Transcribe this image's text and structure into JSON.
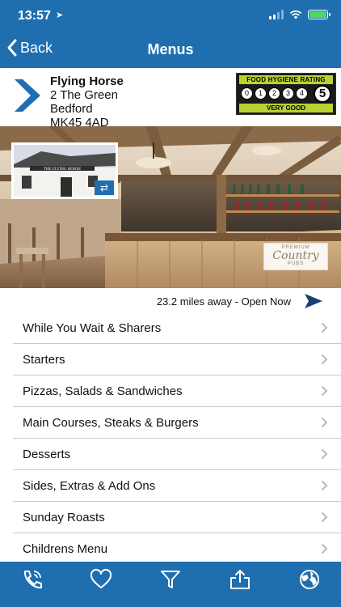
{
  "status_bar": {
    "time": "13:57"
  },
  "nav": {
    "back_label": "Back",
    "title": "Menus"
  },
  "venue": {
    "name": "Flying Horse",
    "address_line1": "2 The Green",
    "address_line2": "Bedford",
    "postcode": "MK45 4AD"
  },
  "hygiene_rating": {
    "header": "FOOD HYGIENE RATING",
    "scale": [
      "0",
      "1",
      "2",
      "3",
      "4"
    ],
    "rating": "5",
    "label": "VERY GOOD"
  },
  "hero": {
    "thumb_sign": "THE FLYING HORSE",
    "brand_top": "PREMIUM",
    "brand_main": "Country",
    "brand_bottom": "PUBS"
  },
  "distance": {
    "text": "23.2 miles away - Open Now"
  },
  "menu_items": [
    {
      "label": "While You Wait & Sharers"
    },
    {
      "label": "Starters"
    },
    {
      "label": "Pizzas, Salads & Sandwiches"
    },
    {
      "label": "Main Courses, Steaks & Burgers"
    },
    {
      "label": "Desserts"
    },
    {
      "label": "Sides, Extras & Add Ons"
    },
    {
      "label": "Sunday Roasts"
    },
    {
      "label": "Childrens Menu"
    }
  ],
  "tab_bar": [
    "phone-icon",
    "heart-icon",
    "filter-icon",
    "share-icon",
    "globe-icon"
  ],
  "colors": {
    "primary": "#1f6fb0",
    "rating_green": "#b6d334"
  }
}
